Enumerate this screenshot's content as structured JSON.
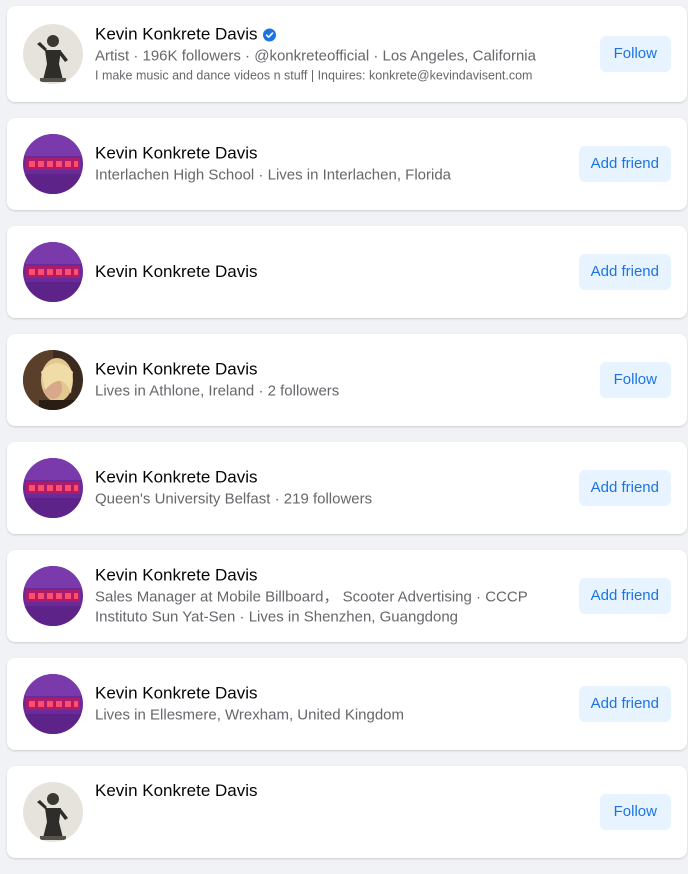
{
  "accent_color": "#1b74e4",
  "button_background": "#e7f3ff",
  "results": [
    {
      "name": "Kevin Konkrete Davis",
      "verified": true,
      "avatar": "statue-photo",
      "meta": "Artist · 196K followers · @konkreteofficial · Los Angeles, California",
      "bio": "I make music and dance videos n stuff | Inquires: konkrete@kevindavisent.com",
      "action": "Follow"
    },
    {
      "name": "Kevin Konkrete Davis",
      "avatar": "purple-logo",
      "meta": "Interlachen High School · Lives in Interlachen, Florida",
      "action": "Add friend"
    },
    {
      "name": "Kevin Konkrete Davis",
      "avatar": "purple-logo",
      "action": "Add friend"
    },
    {
      "name": "Kevin Konkrete Davis",
      "avatar": "person-photo",
      "meta": "Lives in Athlone, Ireland · 2 followers",
      "action": "Follow"
    },
    {
      "name": "Kevin Konkrete Davis",
      "avatar": "purple-logo",
      "meta": "Queen's University Belfast · 219 followers",
      "action": "Add friend"
    },
    {
      "name": "Kevin Konkrete Davis",
      "avatar": "purple-logo",
      "meta": "Sales Manager at Mobile Billboard， Scooter Advertising · CCCP Instituto Sun Yat-Sen · Lives in Shenzhen, Guangdong",
      "action": "Add friend"
    },
    {
      "name": "Kevin Konkrete Davis",
      "avatar": "purple-logo",
      "meta": "Lives in Ellesmere, Wrexham, United Kingdom",
      "action": "Add friend"
    },
    {
      "name": "Kevin Konkrete Davis",
      "avatar": "statue-photo",
      "action": "Follow"
    }
  ]
}
